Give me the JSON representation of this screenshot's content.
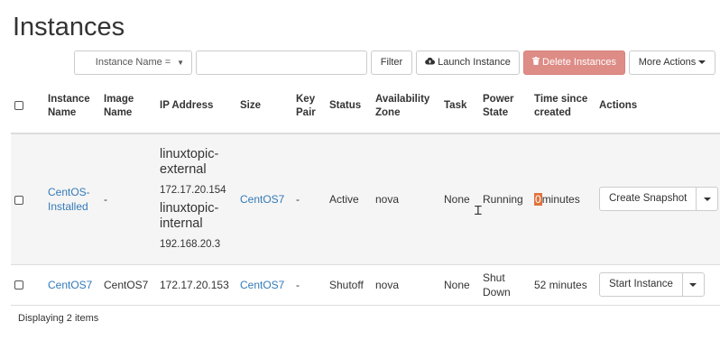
{
  "page": {
    "title": "Instances"
  },
  "toolbar": {
    "filter_field": "Instance Name =",
    "filter_value": "",
    "filter_label": "Filter",
    "launch_label": "Launch Instance",
    "delete_label": "Delete Instances",
    "more_label": "More Actions"
  },
  "table": {
    "headers": {
      "instance_name": "Instance Name",
      "image_name": "Image Name",
      "ip_address": "IP Address",
      "size": "Size",
      "key_pair": "Key Pair",
      "status": "Status",
      "availability_zone": "Availability Zone",
      "task": "Task",
      "power_state": "Power State",
      "time_since_created": "Time since created",
      "actions": "Actions"
    },
    "rows": [
      {
        "name": "CentOS-Installed",
        "image": "-",
        "ips": [
          {
            "label": "linuxtopic-external",
            "value": "172.17.20.154"
          },
          {
            "label": "linuxtopic-internal",
            "value": "192.168.20.3"
          }
        ],
        "size": "CentOS7",
        "key_pair": "-",
        "status": "Active",
        "zone": "nova",
        "task": "None",
        "power": "Running",
        "time_num": "0",
        "time_unit": "minutes",
        "action": "Create Snapshot"
      },
      {
        "name": "CentOS7",
        "image": "CentOS7",
        "ip": "172.17.20.153",
        "size": "CentOS7",
        "key_pair": "-",
        "status": "Shutoff",
        "zone": "nova",
        "task": "None",
        "power": "Shut Down",
        "time": "52 minutes",
        "action": "Start Instance"
      }
    ]
  },
  "footer": {
    "count": "Displaying 2 items"
  },
  "colors": {
    "link": "#337ab7",
    "danger": "#de8c86",
    "highlight": "#e0733f",
    "row_shade": "#f5f5f5"
  }
}
